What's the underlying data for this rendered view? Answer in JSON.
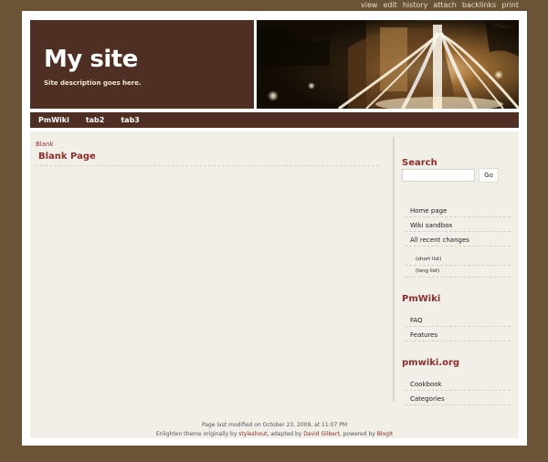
{
  "top_actions": [
    "view",
    "edit",
    "history",
    "attach",
    "backlinks",
    "print"
  ],
  "header": {
    "site_title": "My site",
    "site_description": "Site description goes here."
  },
  "nav_tabs": [
    "PmWiki",
    "tab2",
    "tab3"
  ],
  "main": {
    "breadcrumb": "Blank",
    "page_title": "Blank Page"
  },
  "sidebar": {
    "search_heading": "Search",
    "search_value": "",
    "go_label": "Go",
    "search_links": [
      "Home page",
      "Wiki sandbox",
      "All recent changes"
    ],
    "recent_sub_links": [
      "(short list)",
      "(long list)"
    ],
    "pmwiki_heading": "PmWiki",
    "pmwiki_links": [
      "FAQ",
      "Features"
    ],
    "pmwikiorg_heading": "pmwiki.org",
    "pmwikiorg_links": [
      "Cookbook",
      "Categories"
    ]
  },
  "footer": {
    "line1": "Page last modified on October 23, 2009, at 11:07 PM",
    "line2_prefix": "Enlighten theme originally by ",
    "line2_link1": "styleshout",
    "line2_mid": ", adapted by ",
    "line2_link2": "David Gilbert",
    "line2_mid2": ", powered by ",
    "line2_link3": "BlogIt"
  },
  "colors": {
    "page_background": "#6b5338",
    "header_dark": "#4f2e24",
    "content_background": "#f2efe9",
    "link_red": "#8b2e2e"
  }
}
